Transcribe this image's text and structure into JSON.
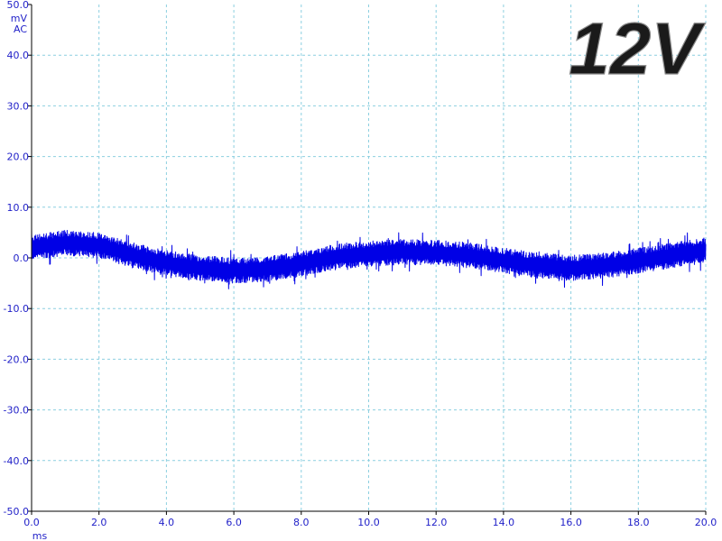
{
  "overlay": {
    "label": "12V"
  },
  "axis": {
    "y_unit": "mV",
    "y_coupling": "AC",
    "x_unit": "ms"
  },
  "colors": {
    "trace": "#0000e6",
    "tick_text": "#1f1fc8",
    "grid": "#8ccfe0",
    "axis": "#000000"
  },
  "chart_data": {
    "type": "line",
    "title": "",
    "xlabel": "ms",
    "ylabel": "mV",
    "xlim": [
      0.0,
      20.0
    ],
    "ylim": [
      -50.0,
      50.0
    ],
    "x_ticks": [
      "0.0",
      "2.0",
      "4.0",
      "6.0",
      "8.0",
      "10.0",
      "12.0",
      "14.0",
      "16.0",
      "18.0",
      "20.0"
    ],
    "y_ticks": [
      "50.0",
      "40.0",
      "30.0",
      "20.0",
      "10.0",
      "0.0",
      "-10.0",
      "-20.0",
      "-30.0",
      "-40.0",
      "-50.0"
    ],
    "grid": true,
    "series": [
      {
        "name": "",
        "x": [
          0.0,
          1.0,
          2.0,
          3.0,
          4.0,
          5.0,
          6.0,
          7.0,
          8.0,
          9.0,
          10.0,
          11.0,
          12.0,
          13.0,
          14.0,
          15.0,
          16.0,
          17.0,
          18.0,
          19.0,
          20.0
        ],
        "y_center": [
          2.0,
          3.0,
          2.5,
          0.5,
          -1.0,
          -2.0,
          -2.5,
          -2.2,
          -1.2,
          0.2,
          0.8,
          1.2,
          1.0,
          0.5,
          -0.5,
          -1.5,
          -2.0,
          -1.5,
          -0.5,
          0.5,
          1.5
        ],
        "band_half_width": 2.5
      }
    ]
  }
}
